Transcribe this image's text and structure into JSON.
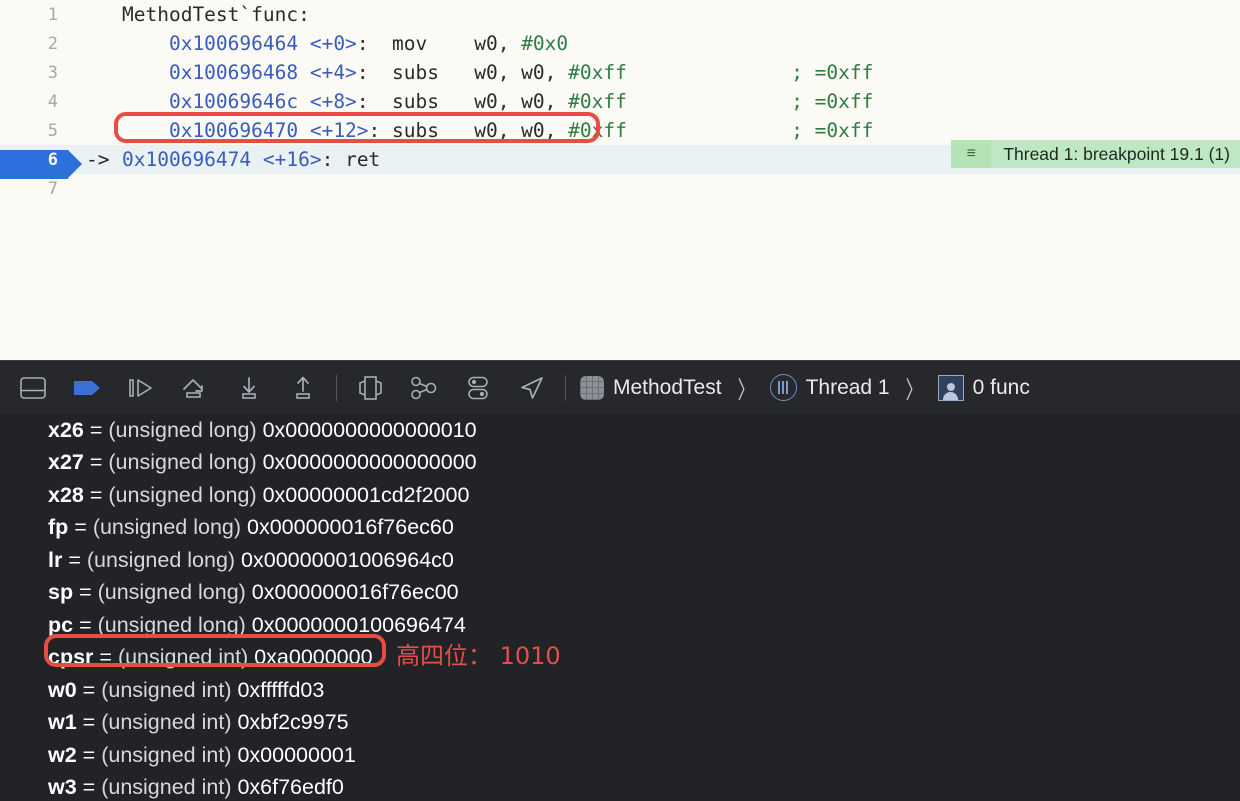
{
  "editor": {
    "lines": [
      {
        "num": "1",
        "pc": "",
        "current": false,
        "tokens": [
          {
            "t": "sym",
            "v": "MethodTest`func:"
          }
        ]
      },
      {
        "num": "2",
        "pc": "",
        "current": false,
        "tokens": [
          {
            "t": "addr",
            "v": "    0x100696464 <+0>"
          },
          {
            "t": "brk",
            "v": ":  mov    "
          },
          {
            "t": "reg",
            "v": "w0, "
          },
          {
            "t": "imm",
            "v": "#0x0"
          }
        ]
      },
      {
        "num": "3",
        "pc": "",
        "current": false,
        "tokens": [
          {
            "t": "addr",
            "v": "    0x100696468 <+4>"
          },
          {
            "t": "brk",
            "v": ":  subs   "
          },
          {
            "t": "reg",
            "v": "w0, w0, "
          },
          {
            "t": "imm",
            "v": "#0xff"
          },
          {
            "t": "cmt",
            "v": "              ; =0xff"
          }
        ]
      },
      {
        "num": "4",
        "pc": "",
        "current": false,
        "tokens": [
          {
            "t": "addr",
            "v": "    0x10069646c <+8>"
          },
          {
            "t": "brk",
            "v": ":  subs   "
          },
          {
            "t": "reg",
            "v": "w0, w0, "
          },
          {
            "t": "imm",
            "v": "#0xff"
          },
          {
            "t": "cmt",
            "v": "              ; =0xff"
          }
        ]
      },
      {
        "num": "5",
        "pc": "",
        "current": false,
        "tokens": [
          {
            "t": "addr",
            "v": "    0x100696470 <+12>"
          },
          {
            "t": "brk",
            "v": ": subs   "
          },
          {
            "t": "reg",
            "v": "w0, w0, "
          },
          {
            "t": "imm",
            "v": "#0xff"
          },
          {
            "t": "cmt",
            "v": "              ; =0xff"
          }
        ]
      },
      {
        "num": "6",
        "pc": "->",
        "current": true,
        "tokens": [
          {
            "t": "addr",
            "v": "0x100696474 <+16>"
          },
          {
            "t": "brk",
            "v": ": ret"
          }
        ]
      },
      {
        "num": "7",
        "pc": "",
        "current": false,
        "tokens": []
      }
    ],
    "breakpoint_badge": {
      "handle_icon": "hamburger-icon",
      "handle_glyph": "≡",
      "text": "Thread 1: breakpoint 19.1 (1)"
    },
    "annotation_rect_color": "#e84c42"
  },
  "debugbar": {
    "buttons": [
      {
        "name": "toggle-debug-area-button",
        "icon": "panel-bottom-icon"
      },
      {
        "name": "continue-button",
        "icon": "continue-flag-icon"
      },
      {
        "name": "step-over-button",
        "icon": "step-over-icon"
      },
      {
        "name": "step-into-button",
        "icon": "step-into-icon"
      },
      {
        "name": "step-down-button",
        "icon": "step-down-icon"
      },
      {
        "name": "step-up-button",
        "icon": "step-up-icon"
      },
      {
        "name": "debug-view-hierarchy-button",
        "icon": "view-hierarchy-icon"
      },
      {
        "name": "debug-memory-graph-button",
        "icon": "memory-graph-icon"
      },
      {
        "name": "environment-overrides-button",
        "icon": "environment-overrides-icon"
      },
      {
        "name": "simulate-location-button",
        "icon": "location-arrow-icon"
      }
    ],
    "breadcrumbs": [
      {
        "name": "breadcrumb-process",
        "icon": "app-icon",
        "label": "MethodTest"
      },
      {
        "name": "breadcrumb-thread",
        "icon": "thread-icon",
        "label": "Thread 1"
      },
      {
        "name": "breadcrumb-frame",
        "icon": "frame-icon",
        "label": "0 func"
      }
    ],
    "separator_glyph": "〉"
  },
  "variables": {
    "registers": [
      {
        "name": "x26",
        "type": "(unsigned long)",
        "value": "0x0000000000000010"
      },
      {
        "name": "x27",
        "type": "(unsigned long)",
        "value": "0x0000000000000000"
      },
      {
        "name": "x28",
        "type": "(unsigned long)",
        "value": "0x00000001cd2f2000"
      },
      {
        "name": "fp",
        "type": "(unsigned long)",
        "value": "0x000000016f76ec60"
      },
      {
        "name": "lr",
        "type": "(unsigned long)",
        "value": "0x00000001006964c0"
      },
      {
        "name": "sp",
        "type": "(unsigned long)",
        "value": "0x000000016f76ec00"
      },
      {
        "name": "pc",
        "type": "(unsigned long)",
        "value": "0x0000000100696474"
      },
      {
        "name": "cpsr",
        "type": "(unsigned int)",
        "value": "0xa0000000"
      },
      {
        "name": "w0",
        "type": "(unsigned int)",
        "value": "0xfffffd03"
      },
      {
        "name": "w1",
        "type": "(unsigned int)",
        "value": "0xbf2c9975"
      },
      {
        "name": "w2",
        "type": "(unsigned int)",
        "value": "0x00000001"
      },
      {
        "name": "w3",
        "type": "(unsigned int)",
        "value": "0x6f76edf0"
      }
    ],
    "equals": "=",
    "annotation": {
      "text": "高四位： 1010",
      "color": "#e0504a"
    }
  }
}
